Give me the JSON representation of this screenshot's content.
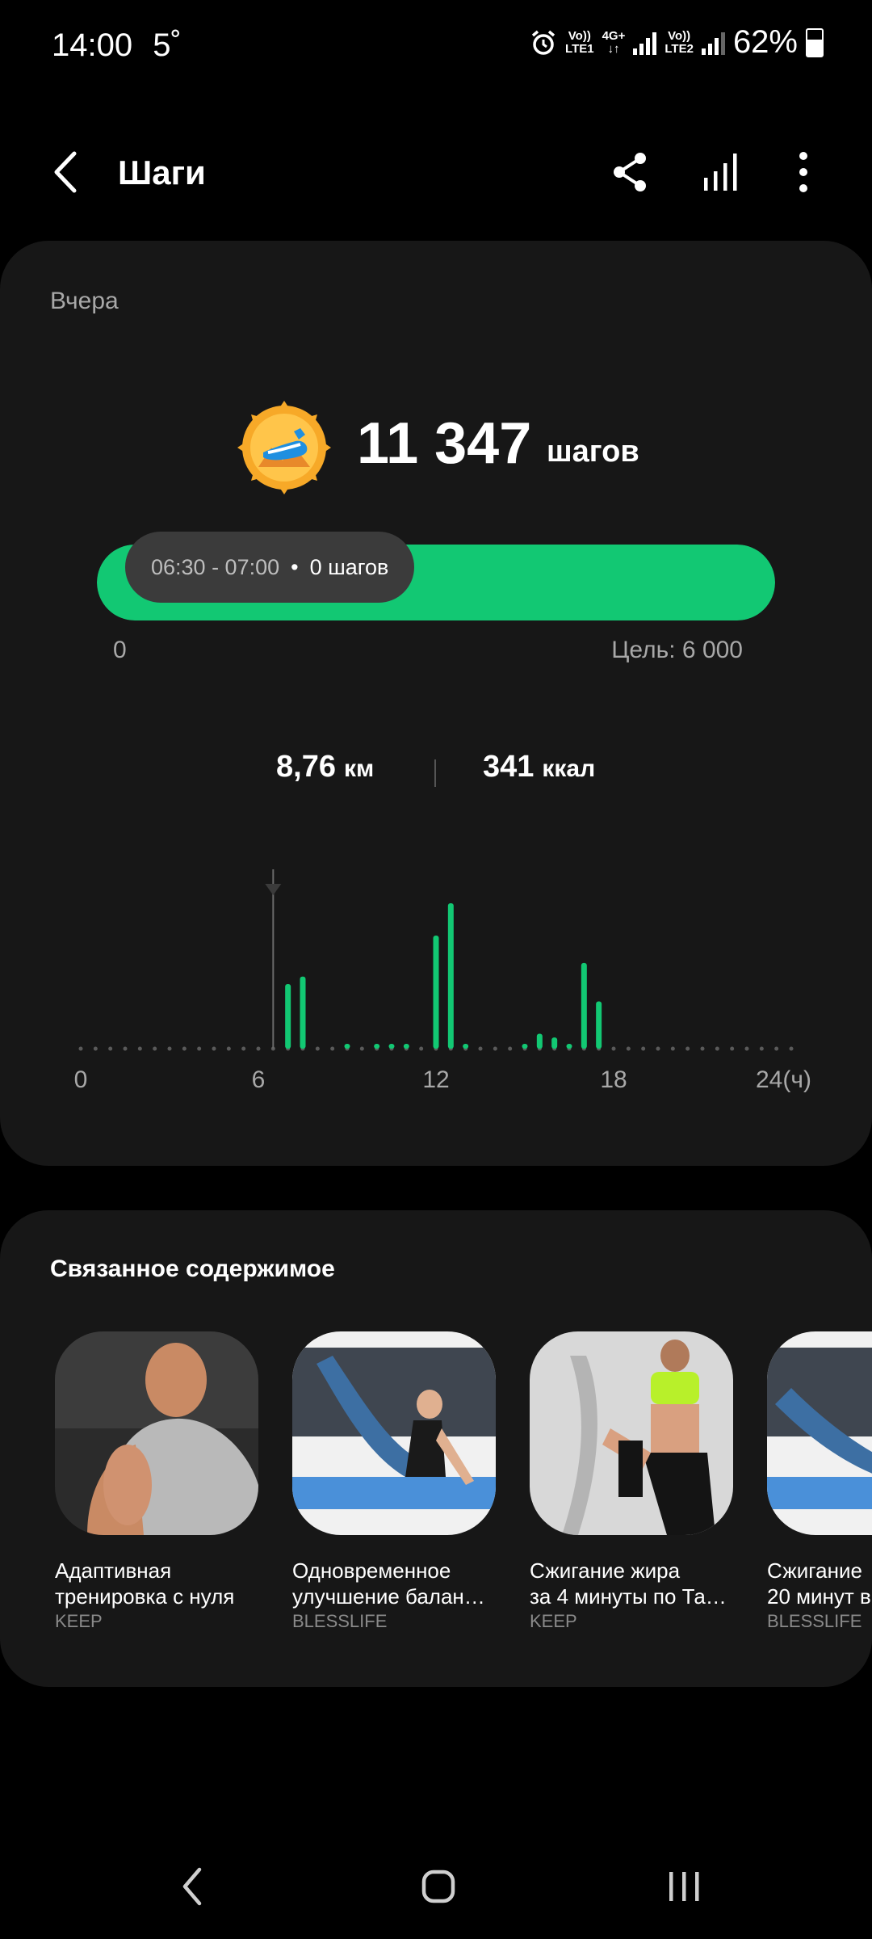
{
  "status_bar": {
    "time": "14:00",
    "temperature": "5˚",
    "sim1_top": "Vo))",
    "sim1_bottom": "LTE1",
    "net_top": "4G+",
    "net_bottom": "↓↑",
    "sim2_top": "Vo))",
    "sim2_bottom": "LTE2",
    "battery": "62%"
  },
  "header": {
    "title": "Шаги",
    "icons": [
      "back-arrow-icon",
      "share-icon",
      "bar-chart-icon",
      "more-vertical-icon"
    ]
  },
  "summary": {
    "date_label": "Вчера",
    "steps": "11 347",
    "steps_unit": "шагов",
    "goal_progress_fraction": 1.0,
    "progress_min_label": "0",
    "goal_label": "Цель: 6 000",
    "distance_value": "8,76",
    "distance_unit": "км",
    "calories_value": "341",
    "calories_unit": "ккал"
  },
  "tooltip": {
    "range": "06:30 - 07:00",
    "bullet": "•",
    "value": "0 шагов"
  },
  "chart_data": {
    "type": "bar",
    "x_unit": "hour",
    "xlim": [
      0,
      24
    ],
    "x_ticks": [
      "0",
      "6",
      "12",
      "18",
      "24(ч)"
    ],
    "selected_x": 6.5,
    "accent_color": "#12c873",
    "series": [
      {
        "values": [
          {
            "x": 7.0,
            "y": 52
          },
          {
            "x": 7.5,
            "y": 58
          },
          {
            "x": 9.0,
            "y": 1
          },
          {
            "x": 10.0,
            "y": 1
          },
          {
            "x": 10.5,
            "y": 1
          },
          {
            "x": 11.0,
            "y": 1
          },
          {
            "x": 12.0,
            "y": 91
          },
          {
            "x": 12.5,
            "y": 117
          },
          {
            "x": 13.0,
            "y": 1
          },
          {
            "x": 15.0,
            "y": 1
          },
          {
            "x": 15.5,
            "y": 12
          },
          {
            "x": 16.0,
            "y": 9
          },
          {
            "x": 16.5,
            "y": 2
          },
          {
            "x": 17.0,
            "y": 69
          },
          {
            "x": 17.5,
            "y": 38
          }
        ]
      }
    ]
  },
  "related": {
    "title": "Связанное содержимое",
    "items": [
      {
        "line1": "Адаптивная",
        "line2": "тренировка с нуля",
        "source": "KEEP"
      },
      {
        "line1": "Одновременное",
        "line2": "улучшение балан…",
        "source": "BLESSLIFE"
      },
      {
        "line1": "Сжигание жира",
        "line2": "за 4 минуты по Та…",
        "source": "KEEP"
      },
      {
        "line1": "Сжигание",
        "line2": "20 минут в",
        "source": "BLESSLIFE"
      }
    ]
  },
  "navbar": {
    "icons": [
      "back-icon",
      "home-icon",
      "recents-icon"
    ]
  }
}
